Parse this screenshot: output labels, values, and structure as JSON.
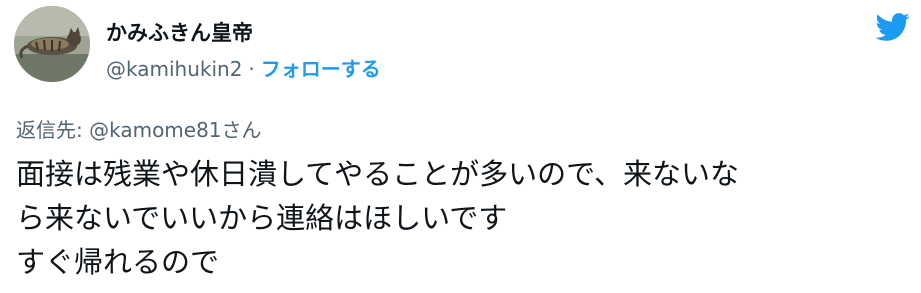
{
  "author": {
    "display_name": "かみふきん皇帝",
    "handle": "@kamihukin2",
    "separator": "·",
    "follow_label": "フォローする",
    "avatar_icon": "cat-photo-avatar"
  },
  "brand_icon": "twitter-bird-icon",
  "colors": {
    "accent": "#1d9bf0",
    "text": "#0f1419",
    "secondary_text": "#536471"
  },
  "reply": {
    "text": "返信先: @kamome81さん"
  },
  "tweet": {
    "lines": [
      "面接は残業や休日潰してやることが多いので、来ないな",
      "ら来ないでいいから連絡はほしいです",
      "すぐ帰れるので"
    ]
  }
}
